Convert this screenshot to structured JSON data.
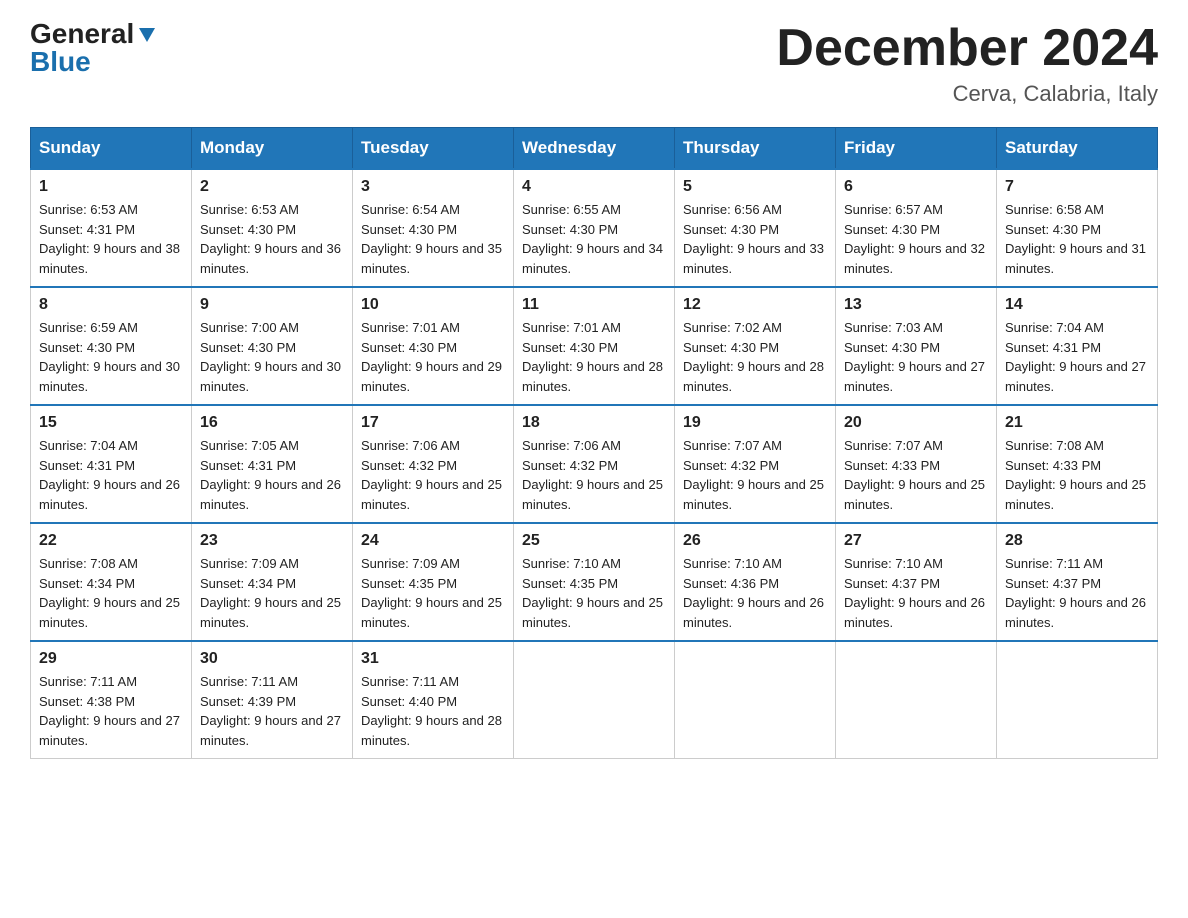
{
  "header": {
    "logo_general": "General",
    "logo_blue": "Blue",
    "month_title": "December 2024",
    "location": "Cerva, Calabria, Italy"
  },
  "weekdays": [
    "Sunday",
    "Monday",
    "Tuesday",
    "Wednesday",
    "Thursday",
    "Friday",
    "Saturday"
  ],
  "weeks": [
    [
      {
        "day": "1",
        "sunrise": "6:53 AM",
        "sunset": "4:31 PM",
        "daylight": "9 hours and 38 minutes."
      },
      {
        "day": "2",
        "sunrise": "6:53 AM",
        "sunset": "4:30 PM",
        "daylight": "9 hours and 36 minutes."
      },
      {
        "day": "3",
        "sunrise": "6:54 AM",
        "sunset": "4:30 PM",
        "daylight": "9 hours and 35 minutes."
      },
      {
        "day": "4",
        "sunrise": "6:55 AM",
        "sunset": "4:30 PM",
        "daylight": "9 hours and 34 minutes."
      },
      {
        "day": "5",
        "sunrise": "6:56 AM",
        "sunset": "4:30 PM",
        "daylight": "9 hours and 33 minutes."
      },
      {
        "day": "6",
        "sunrise": "6:57 AM",
        "sunset": "4:30 PM",
        "daylight": "9 hours and 32 minutes."
      },
      {
        "day": "7",
        "sunrise": "6:58 AM",
        "sunset": "4:30 PM",
        "daylight": "9 hours and 31 minutes."
      }
    ],
    [
      {
        "day": "8",
        "sunrise": "6:59 AM",
        "sunset": "4:30 PM",
        "daylight": "9 hours and 30 minutes."
      },
      {
        "day": "9",
        "sunrise": "7:00 AM",
        "sunset": "4:30 PM",
        "daylight": "9 hours and 30 minutes."
      },
      {
        "day": "10",
        "sunrise": "7:01 AM",
        "sunset": "4:30 PM",
        "daylight": "9 hours and 29 minutes."
      },
      {
        "day": "11",
        "sunrise": "7:01 AM",
        "sunset": "4:30 PM",
        "daylight": "9 hours and 28 minutes."
      },
      {
        "day": "12",
        "sunrise": "7:02 AM",
        "sunset": "4:30 PM",
        "daylight": "9 hours and 28 minutes."
      },
      {
        "day": "13",
        "sunrise": "7:03 AM",
        "sunset": "4:30 PM",
        "daylight": "9 hours and 27 minutes."
      },
      {
        "day": "14",
        "sunrise": "7:04 AM",
        "sunset": "4:31 PM",
        "daylight": "9 hours and 27 minutes."
      }
    ],
    [
      {
        "day": "15",
        "sunrise": "7:04 AM",
        "sunset": "4:31 PM",
        "daylight": "9 hours and 26 minutes."
      },
      {
        "day": "16",
        "sunrise": "7:05 AM",
        "sunset": "4:31 PM",
        "daylight": "9 hours and 26 minutes."
      },
      {
        "day": "17",
        "sunrise": "7:06 AM",
        "sunset": "4:32 PM",
        "daylight": "9 hours and 25 minutes."
      },
      {
        "day": "18",
        "sunrise": "7:06 AM",
        "sunset": "4:32 PM",
        "daylight": "9 hours and 25 minutes."
      },
      {
        "day": "19",
        "sunrise": "7:07 AM",
        "sunset": "4:32 PM",
        "daylight": "9 hours and 25 minutes."
      },
      {
        "day": "20",
        "sunrise": "7:07 AM",
        "sunset": "4:33 PM",
        "daylight": "9 hours and 25 minutes."
      },
      {
        "day": "21",
        "sunrise": "7:08 AM",
        "sunset": "4:33 PM",
        "daylight": "9 hours and 25 minutes."
      }
    ],
    [
      {
        "day": "22",
        "sunrise": "7:08 AM",
        "sunset": "4:34 PM",
        "daylight": "9 hours and 25 minutes."
      },
      {
        "day": "23",
        "sunrise": "7:09 AM",
        "sunset": "4:34 PM",
        "daylight": "9 hours and 25 minutes."
      },
      {
        "day": "24",
        "sunrise": "7:09 AM",
        "sunset": "4:35 PM",
        "daylight": "9 hours and 25 minutes."
      },
      {
        "day": "25",
        "sunrise": "7:10 AM",
        "sunset": "4:35 PM",
        "daylight": "9 hours and 25 minutes."
      },
      {
        "day": "26",
        "sunrise": "7:10 AM",
        "sunset": "4:36 PM",
        "daylight": "9 hours and 26 minutes."
      },
      {
        "day": "27",
        "sunrise": "7:10 AM",
        "sunset": "4:37 PM",
        "daylight": "9 hours and 26 minutes."
      },
      {
        "day": "28",
        "sunrise": "7:11 AM",
        "sunset": "4:37 PM",
        "daylight": "9 hours and 26 minutes."
      }
    ],
    [
      {
        "day": "29",
        "sunrise": "7:11 AM",
        "sunset": "4:38 PM",
        "daylight": "9 hours and 27 minutes."
      },
      {
        "day": "30",
        "sunrise": "7:11 AM",
        "sunset": "4:39 PM",
        "daylight": "9 hours and 27 minutes."
      },
      {
        "day": "31",
        "sunrise": "7:11 AM",
        "sunset": "4:40 PM",
        "daylight": "9 hours and 28 minutes."
      },
      null,
      null,
      null,
      null
    ]
  ]
}
